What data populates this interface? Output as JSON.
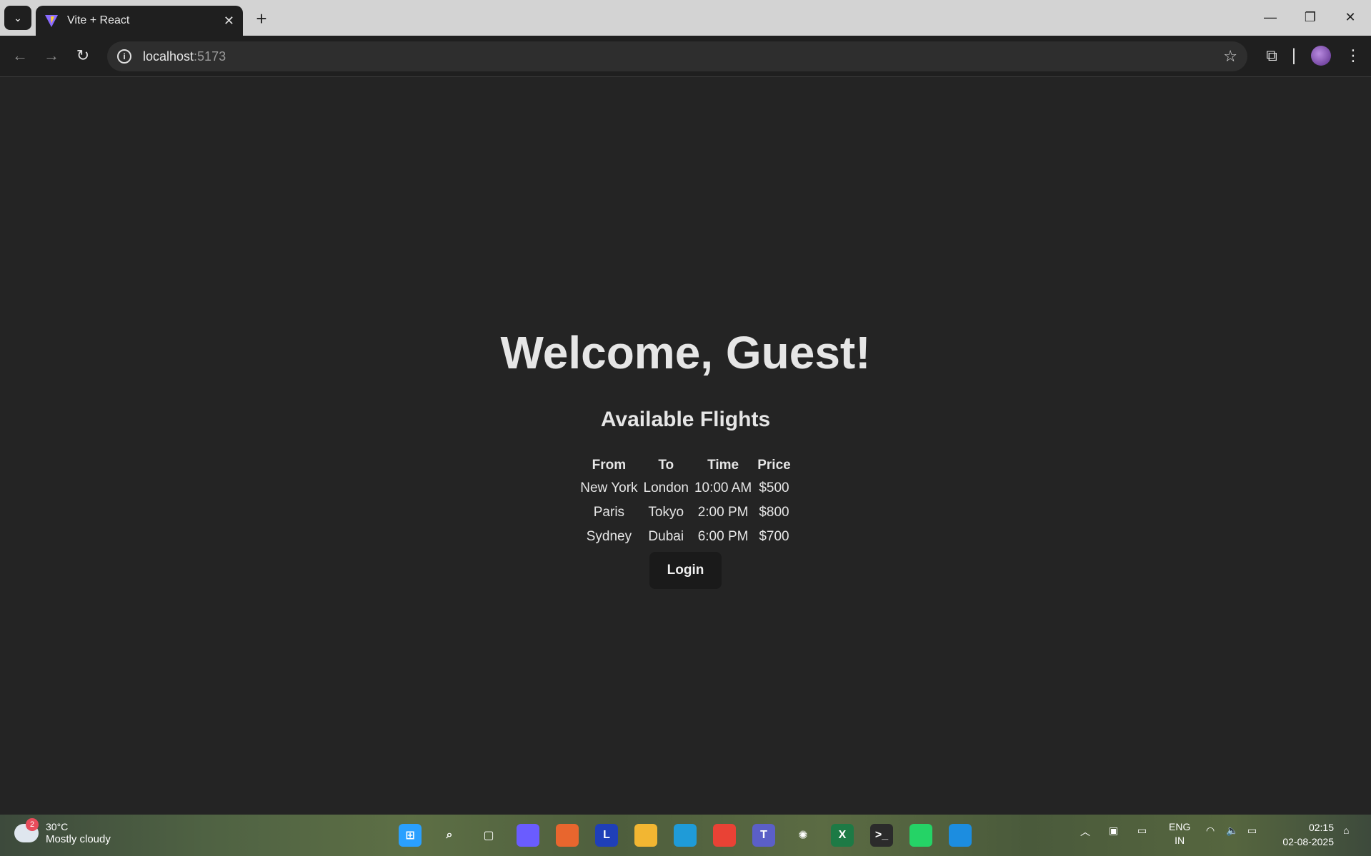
{
  "browser": {
    "tab_title": "Vite + React",
    "url_host": "localhost",
    "url_port": ":5173"
  },
  "page": {
    "heading": "Welcome, Guest!",
    "subheading": "Available Flights",
    "table_headers": [
      "From",
      "To",
      "Time",
      "Price"
    ],
    "flights": [
      {
        "from": "New York",
        "to": "London",
        "time": "10:00 AM",
        "price": "$500"
      },
      {
        "from": "Paris",
        "to": "Tokyo",
        "time": "2:00 PM",
        "price": "$800"
      },
      {
        "from": "Sydney",
        "to": "Dubai",
        "time": "6:00 PM",
        "price": "$700"
      }
    ],
    "login_label": "Login"
  },
  "taskbar": {
    "weather_badge": "2",
    "temperature": "30°C",
    "weather_desc": "Mostly cloudy",
    "lang_line1": "ENG",
    "lang_line2": "IN",
    "time": "02:15",
    "date": "02-08-2025",
    "apps": [
      {
        "name": "start-icon",
        "color": "#2aa0ff"
      },
      {
        "name": "search-icon",
        "color": "transparent"
      },
      {
        "name": "task-view-icon",
        "color": "transparent"
      },
      {
        "name": "copilot-icon",
        "color": "#6a5cff"
      },
      {
        "name": "app-orange-icon",
        "color": "#e8662e"
      },
      {
        "name": "app-l-icon",
        "color": "#1f3fb8",
        "label": "L"
      },
      {
        "name": "file-explorer-icon",
        "color": "#f2b632"
      },
      {
        "name": "edge-icon",
        "color": "#1f9bd8"
      },
      {
        "name": "chrome-icon",
        "color": "#e94235"
      },
      {
        "name": "teams-icon",
        "color": "#5b5fc7",
        "label": "T"
      },
      {
        "name": "chatgpt-icon",
        "color": "transparent"
      },
      {
        "name": "excel-icon",
        "color": "#1d7a45",
        "label": "X"
      },
      {
        "name": "terminal-icon",
        "color": "#2b2b2b"
      },
      {
        "name": "whatsapp-icon",
        "color": "#25d366"
      },
      {
        "name": "vscode-icon",
        "color": "#1c8de0"
      }
    ]
  }
}
